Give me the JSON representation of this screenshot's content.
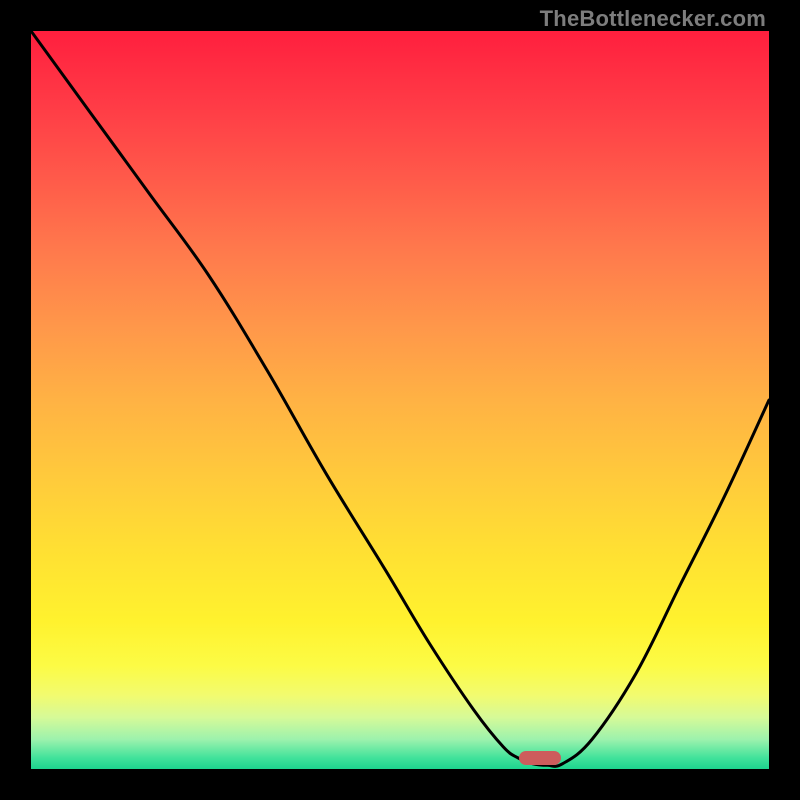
{
  "watermark": {
    "text": "TheBottlenecker.com"
  },
  "colors": {
    "page_bg": "#000000",
    "marker": "#cd5c5c",
    "curve": "#000000",
    "watermark": "#7d7d7d"
  },
  "chart_data": {
    "type": "line",
    "title": "",
    "xlabel": "",
    "ylabel": "",
    "xlim": [
      0,
      100
    ],
    "ylim": [
      0,
      100
    ],
    "grid": false,
    "legend": false,
    "series": [
      {
        "name": "bottleneck-curve",
        "x": [
          0,
          8,
          16,
          24,
          32,
          40,
          48,
          54,
          60,
          64,
          66,
          68,
          70,
          72,
          76,
          82,
          88,
          94,
          100
        ],
        "values": [
          100,
          89,
          78,
          67,
          54,
          40,
          27,
          17,
          8,
          3,
          1.5,
          0.7,
          0.5,
          0.7,
          4,
          13,
          25,
          37,
          50
        ]
      }
    ],
    "marker": {
      "x": 69,
      "y": 1.5
    },
    "background_gradient_stops": [
      {
        "pos": 0,
        "color": "#ff1f3e"
      },
      {
        "pos": 10,
        "color": "#ff3b46"
      },
      {
        "pos": 20,
        "color": "#ff5a4a"
      },
      {
        "pos": 30,
        "color": "#ff7a4c"
      },
      {
        "pos": 40,
        "color": "#ff974a"
      },
      {
        "pos": 50,
        "color": "#ffb244"
      },
      {
        "pos": 60,
        "color": "#ffc93c"
      },
      {
        "pos": 70,
        "color": "#ffdf33"
      },
      {
        "pos": 80,
        "color": "#fff22e"
      },
      {
        "pos": 86,
        "color": "#fcfb45"
      },
      {
        "pos": 90,
        "color": "#f2fb6f"
      },
      {
        "pos": 93,
        "color": "#d6fa98"
      },
      {
        "pos": 96,
        "color": "#9cf2ad"
      },
      {
        "pos": 98.5,
        "color": "#41e29b"
      },
      {
        "pos": 100,
        "color": "#1dd48e"
      }
    ]
  }
}
